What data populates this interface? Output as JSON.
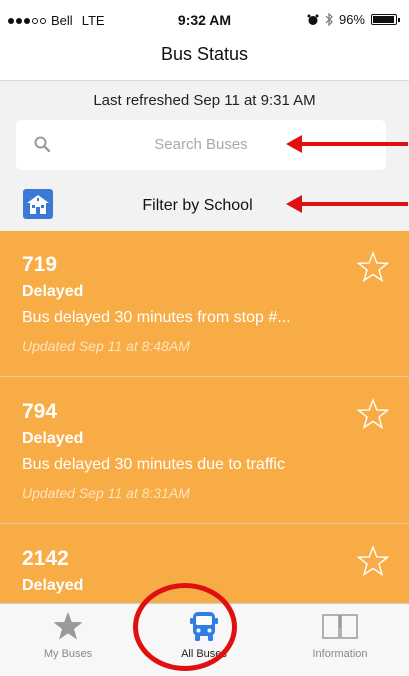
{
  "status_bar": {
    "carrier": "Bell",
    "network": "LTE",
    "time": "9:32 AM",
    "battery": "96%",
    "battery_level": 0.96,
    "signal_dots_filled": 3,
    "signal_dots_total": 5
  },
  "nav": {
    "title": "Bus Status"
  },
  "refresh": {
    "text": "Last refreshed Sep 11 at 9:31 AM"
  },
  "search": {
    "placeholder": "Search Buses",
    "icon": "search-icon"
  },
  "filter": {
    "label": "Filter by School",
    "icon": "school-icon"
  },
  "buses": [
    {
      "number": "719",
      "status": "Delayed",
      "description": "Bus delayed 30 minutes from stop #...",
      "updated": "Updated Sep 11 at 8:48AM"
    },
    {
      "number": "794",
      "status": "Delayed",
      "description": "Bus delayed 30 minutes due to traffic",
      "updated": "Updated Sep 11 at 8:31AM"
    },
    {
      "number": "2142",
      "status": "Delayed",
      "description": "",
      "updated": ""
    }
  ],
  "tabs": [
    {
      "label": "My Buses",
      "icon": "star-icon"
    },
    {
      "label": "All Buses",
      "icon": "bus-icon",
      "active": true
    },
    {
      "label": "Information",
      "icon": "book-icon"
    }
  ],
  "colors": {
    "card_background": "#f8ac45",
    "accent_blue": "#2f7ee6",
    "annotation_red": "#e01010"
  }
}
